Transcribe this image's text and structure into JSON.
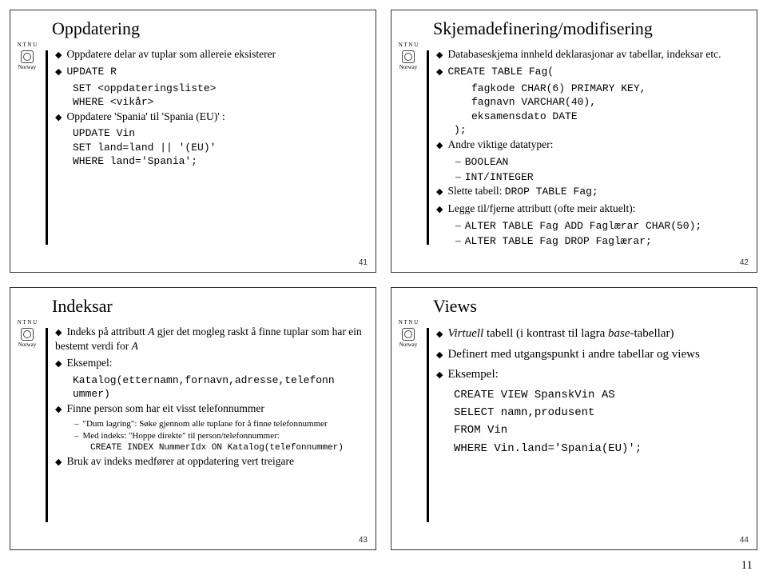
{
  "page_number": "11",
  "logo": {
    "top": "N T N U",
    "bottom": "Norway"
  },
  "slides": [
    {
      "num": "41",
      "title": "Oppdatering",
      "items": [
        {
          "type": "b1",
          "text": "Oppdatere delar av tuplar som allereie eksisterer"
        },
        {
          "type": "b1",
          "text": "UPDATE R",
          "mono": true
        },
        {
          "type": "code",
          "text": "SET <oppdateringsliste>"
        },
        {
          "type": "code",
          "text": "WHERE <vikår>"
        },
        {
          "type": "b1",
          "text": "Oppdatere 'Spania' til 'Spania (EU)' :"
        },
        {
          "type": "code",
          "text": "UPDATE Vin"
        },
        {
          "type": "code",
          "text": "SET land=land || '(EU)'"
        },
        {
          "type": "code",
          "text": "WHERE land='Spania';"
        }
      ]
    },
    {
      "num": "42",
      "title": "Skjemadefinering/modifisering",
      "items": [
        {
          "type": "b1",
          "text": "Databaseskjema innheld deklarasjonar av tabellar, indeksar etc."
        },
        {
          "type": "b1",
          "text": "CREATE TABLE Fag(",
          "mono": true
        },
        {
          "type": "codeind",
          "text": "fagkode CHAR(6) PRIMARY KEY,"
        },
        {
          "type": "codeind",
          "text": "fagnavn VARCHAR(40),"
        },
        {
          "type": "codeind",
          "text": "eksamensdato DATE"
        },
        {
          "type": "code",
          "text": ");"
        },
        {
          "type": "b1",
          "text": "Andre viktige datatyper:"
        },
        {
          "type": "sub",
          "text": "BOOLEAN",
          "mono": true
        },
        {
          "type": "sub",
          "text": "INT/INTEGER",
          "mono": true
        },
        {
          "type": "b1mix",
          "prefix": "Slette tabell: ",
          "code": "DROP TABLE Fag;"
        },
        {
          "type": "b1",
          "text": "Legge til/fjerne attributt (ofte meir aktuelt):"
        },
        {
          "type": "sub",
          "text": "ALTER TABLE Fag ADD Faglærar CHAR(50);",
          "mono": true
        },
        {
          "type": "sub",
          "text": "ALTER TABLE Fag DROP Faglærar;",
          "mono": true
        }
      ]
    },
    {
      "num": "43",
      "title": "Indeksar",
      "items": [
        {
          "type": "b1html",
          "html": "Indeks på attributt <em>A</em> gjer det mogleg raskt å finne tuplar som har ein bestemt verdi for <em>A</em>"
        },
        {
          "type": "b1",
          "text": "Eksempel:"
        },
        {
          "type": "code",
          "text": "Katalog(etternamn,fornavn,adresse,telefonn"
        },
        {
          "type": "code",
          "text": "ummer)"
        },
        {
          "type": "b1",
          "text": "Finne person som har eit visst telefonnummer"
        },
        {
          "type": "subsmall",
          "text": "\"Dum lagring\": Søke gjennom alle tuplane for å finne telefonnummer"
        },
        {
          "type": "subsmall",
          "text": "Med indeks: \"Hoppe direkte\" til person/telefonnummer:"
        },
        {
          "type": "codeind2",
          "text": "CREATE INDEX NummerIdx ON Katalog(telefonnummer)"
        },
        {
          "type": "b1",
          "text": "Bruk av indeks medfører at oppdatering vert treigare"
        }
      ]
    },
    {
      "num": "44",
      "title": "Views",
      "items": [
        {
          "type": "b1html",
          "html": "<em>Virtuell</em> tabell (i kontrast til lagra <em>base</em>-tabellar)"
        },
        {
          "type": "b1",
          "text": "Definert med utgangspunkt i andre tabellar og views"
        },
        {
          "type": "b1",
          "text": "Eksempel:"
        },
        {
          "type": "code",
          "text": "CREATE VIEW SpanskVin AS"
        },
        {
          "type": "code",
          "text": "SELECT namn,produsent"
        },
        {
          "type": "code",
          "text": "FROM Vin"
        },
        {
          "type": "code",
          "text": "WHERE Vin.land='Spania(EU)';"
        }
      ]
    }
  ]
}
